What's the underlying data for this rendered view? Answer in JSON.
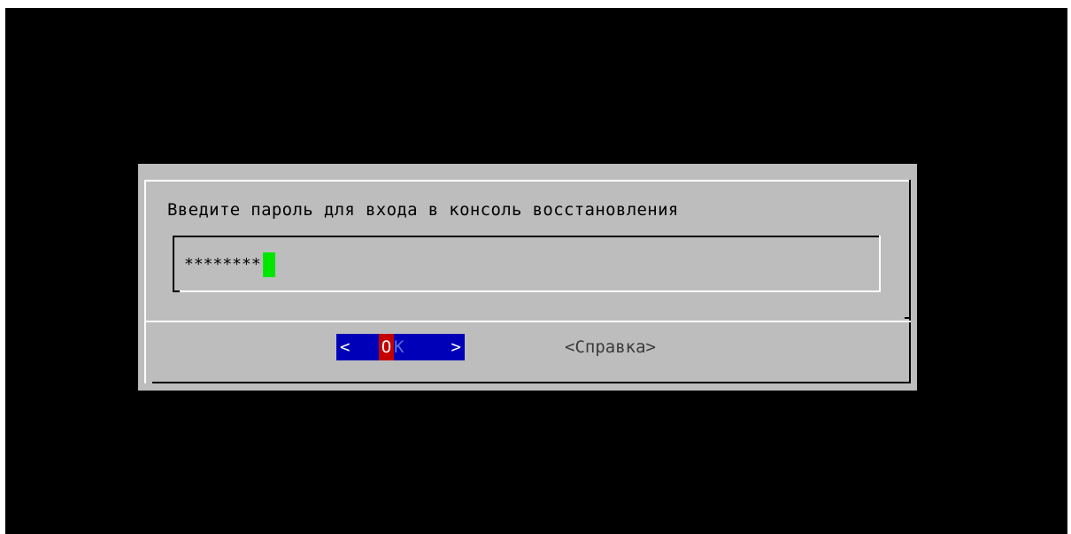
{
  "screen": {
    "background": "#000000"
  },
  "dialog": {
    "background": "#bdbdbd",
    "prompt": "Введите пароль для входа в консоль восстановления",
    "password_field": {
      "masked_value": "********",
      "cursor_color": "#00e600"
    },
    "buttons": {
      "ok": {
        "open_bracket": "<",
        "hotkey_letter": "O",
        "rest_label": "K",
        "close_bracket": ">",
        "selected": true,
        "background": "#0000b8",
        "hotkey_background": "#c40000"
      },
      "help": {
        "label": "<Справка>"
      }
    }
  }
}
